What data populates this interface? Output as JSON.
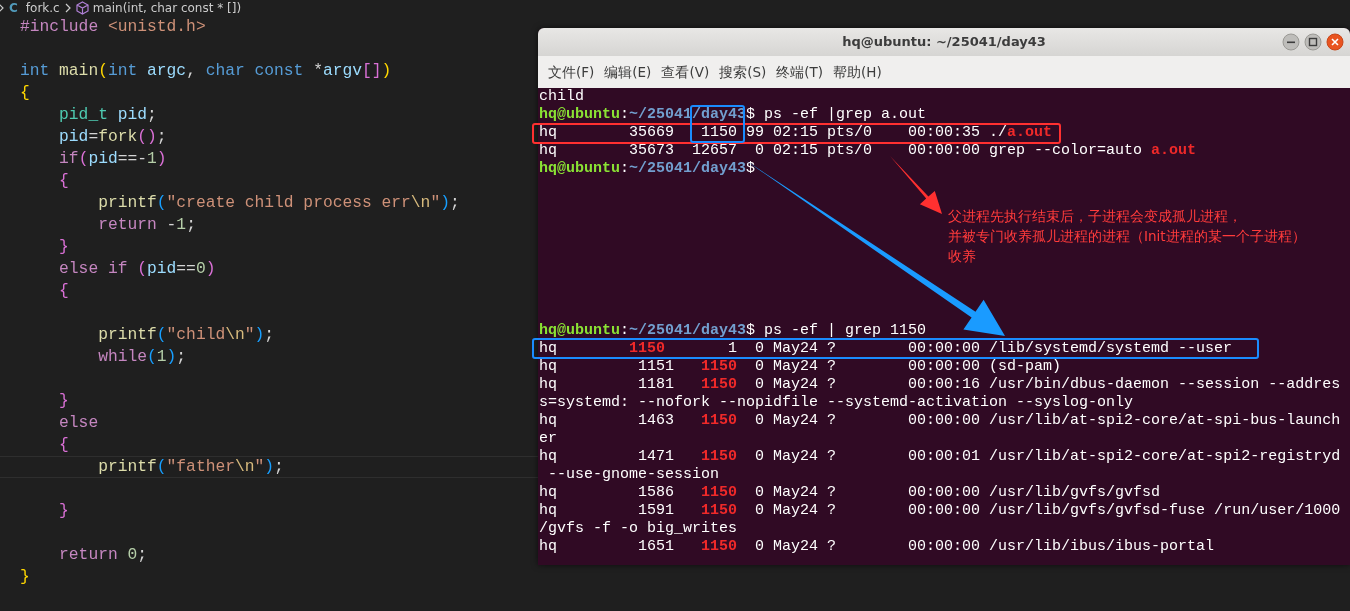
{
  "editor": {
    "breadcrumb": [
      {
        "kind": "chevron"
      },
      {
        "kind": "file",
        "icon_text": "C",
        "label": "fork.c"
      },
      {
        "kind": "chevron"
      },
      {
        "kind": "symbol",
        "label": "main(int, char const * [])"
      }
    ],
    "code_lines": [
      {
        "current": false,
        "tokens": [
          {
            "text": "#include",
            "kind": "pre"
          },
          {
            "text": " <unistd.h>",
            "kind": "inc"
          }
        ]
      },
      {
        "current": false
      },
      {
        "current": false,
        "tokens": [
          {
            "text": "int",
            "kind": "kw"
          },
          {
            "text": " main",
            "kind": "fn"
          },
          {
            "text": "(",
            "kind": "b1"
          },
          {
            "text": "int",
            "kind": "kw"
          },
          {
            "text": " argc",
            "kind": "var"
          },
          {
            "text": ", ",
            "kind": "p"
          },
          {
            "text": "char const",
            "kind": "kw"
          },
          {
            "text": " *",
            "kind": "p"
          },
          {
            "text": "argv",
            "kind": "var"
          },
          {
            "text": "[]",
            "kind": "b2"
          },
          {
            "text": ")",
            "kind": "b1"
          }
        ]
      },
      {
        "current": false,
        "tokens": [
          {
            "text": "{",
            "kind": "b1"
          }
        ]
      },
      {
        "current": false,
        "tokens": [
          {
            "text": "    pid_t",
            "kind": "type"
          },
          {
            "text": " pid",
            "kind": "var"
          },
          {
            "text": ";",
            "kind": "p"
          }
        ]
      },
      {
        "current": false,
        "tokens": [
          {
            "text": "    pid",
            "kind": "var"
          },
          {
            "text": "=",
            "kind": "p"
          },
          {
            "text": "fork",
            "kind": "fn"
          },
          {
            "text": "()",
            "kind": "b2"
          },
          {
            "text": ";",
            "kind": "p"
          }
        ]
      },
      {
        "current": false,
        "tokens": [
          {
            "text": "    if",
            "kind": "ctl"
          },
          {
            "text": "(",
            "kind": "b2"
          },
          {
            "text": "pid",
            "kind": "var"
          },
          {
            "text": "==-",
            "kind": "p"
          },
          {
            "text": "1",
            "kind": "num"
          },
          {
            "text": ")",
            "kind": "b2"
          }
        ]
      },
      {
        "current": false,
        "tokens": [
          {
            "text": "    {",
            "kind": "b2"
          }
        ]
      },
      {
        "current": false,
        "tokens": [
          {
            "text": "        printf",
            "kind": "fn"
          },
          {
            "text": "(",
            "kind": "b3"
          },
          {
            "text": "\"create child process err",
            "kind": "str"
          },
          {
            "text": "\\n",
            "kind": "esc"
          },
          {
            "text": "\"",
            "kind": "str"
          },
          {
            "text": ")",
            "kind": "b3"
          },
          {
            "text": ";",
            "kind": "p"
          }
        ]
      },
      {
        "current": false,
        "tokens": [
          {
            "text": "        return",
            "kind": "ctl"
          },
          {
            "text": " -",
            "kind": "p"
          },
          {
            "text": "1",
            "kind": "num"
          },
          {
            "text": ";",
            "kind": "p"
          }
        ]
      },
      {
        "current": false,
        "tokens": [
          {
            "text": "    }",
            "kind": "b2"
          }
        ]
      },
      {
        "current": false,
        "tokens": [
          {
            "text": "    else if ",
            "kind": "ctl"
          },
          {
            "text": "(",
            "kind": "b2"
          },
          {
            "text": "pid",
            "kind": "var"
          },
          {
            "text": "==",
            "kind": "p"
          },
          {
            "text": "0",
            "kind": "num"
          },
          {
            "text": ")",
            "kind": "b2"
          }
        ]
      },
      {
        "current": false,
        "tokens": [
          {
            "text": "    {",
            "kind": "b2"
          }
        ]
      },
      {
        "current": false
      },
      {
        "current": false,
        "tokens": [
          {
            "text": "        printf",
            "kind": "fn"
          },
          {
            "text": "(",
            "kind": "b3"
          },
          {
            "text": "\"child",
            "kind": "str"
          },
          {
            "text": "\\n",
            "kind": "esc"
          },
          {
            "text": "\"",
            "kind": "str"
          },
          {
            "text": ")",
            "kind": "b3"
          },
          {
            "text": ";",
            "kind": "p"
          }
        ]
      },
      {
        "current": false,
        "tokens": [
          {
            "text": "        while",
            "kind": "ctl"
          },
          {
            "text": "(",
            "kind": "b3"
          },
          {
            "text": "1",
            "kind": "num"
          },
          {
            "text": ")",
            "kind": "b3"
          },
          {
            "text": ";",
            "kind": "p"
          }
        ]
      },
      {
        "current": false
      },
      {
        "current": false,
        "tokens": [
          {
            "text": "    }",
            "kind": "b2"
          }
        ]
      },
      {
        "current": false,
        "tokens": [
          {
            "text": "    else",
            "kind": "ctl"
          }
        ]
      },
      {
        "current": false,
        "tokens": [
          {
            "text": "    {",
            "kind": "b2"
          }
        ]
      },
      {
        "current": true,
        "tokens": [
          {
            "text": "        printf",
            "kind": "fn"
          },
          {
            "text": "(",
            "kind": "b3"
          },
          {
            "text": "\"father",
            "kind": "str"
          },
          {
            "text": "\\n",
            "kind": "esc"
          },
          {
            "text": "\"",
            "kind": "str"
          },
          {
            "text": ")",
            "kind": "b3"
          },
          {
            "text": ";",
            "kind": "p"
          }
        ]
      },
      {
        "current": false
      },
      {
        "current": false,
        "tokens": [
          {
            "text": "    }",
            "kind": "b2"
          }
        ]
      },
      {
        "current": false
      },
      {
        "current": false,
        "tokens": [
          {
            "text": "    return ",
            "kind": "ctl"
          },
          {
            "text": "0",
            "kind": "num"
          },
          {
            "text": ";",
            "kind": "p"
          }
        ]
      },
      {
        "current": false,
        "tokens": [
          {
            "text": "}",
            "kind": "b1"
          }
        ]
      }
    ]
  },
  "terminal": {
    "title": "hq@ubuntu: ~/25041/day43",
    "menu": [
      "文件(F)",
      "编辑(E)",
      "查看(V)",
      "搜索(S)",
      "终端(T)",
      "帮助(H)"
    ],
    "output_top": [
      [
        {
          "text": "child",
          "kind": "plain"
        }
      ],
      [
        {
          "text": "hq@ubuntu",
          "kind": "user"
        },
        {
          "text": ":",
          "kind": "plain"
        },
        {
          "text": "~/25041/",
          "kind": "path"
        },
        {
          "text": "day43",
          "kind": "path"
        },
        {
          "text": "$ ps -ef |grep a.out",
          "kind": "plain"
        }
      ],
      [
        {
          "text": "hq        35669   1150 99 02:15 pts/0    00:00:35 ./",
          "kind": "plain"
        },
        {
          "text": "a.out",
          "kind": "match"
        }
      ],
      [
        {
          "text": "hq        35673  12657  0 02:15 pts/0    00:00:00 grep --color=auto ",
          "kind": "plain"
        },
        {
          "text": "a.out",
          "kind": "match"
        }
      ],
      [
        {
          "text": "hq@ubuntu",
          "kind": "user"
        },
        {
          "text": ":",
          "kind": "plain"
        },
        {
          "text": "~/25041/day43",
          "kind": "path"
        },
        {
          "text": "$",
          "kind": "plain"
        }
      ]
    ],
    "output_bottom": [
      [
        {
          "text": "hq@ubuntu",
          "kind": "user"
        },
        {
          "text": ":",
          "kind": "plain"
        },
        {
          "text": "~/25041/day43",
          "kind": "path"
        },
        {
          "text": "$ ps -ef | grep 1150",
          "kind": "plain"
        }
      ],
      [
        {
          "text": "hq        ",
          "kind": "plain"
        },
        {
          "text": "1150",
          "kind": "match"
        },
        {
          "text": "       1  0 May24 ?        00:00:00 /lib/systemd/systemd --user",
          "kind": "plain"
        }
      ],
      [
        {
          "text": "hq         1151   ",
          "kind": "plain"
        },
        {
          "text": "1150",
          "kind": "match"
        },
        {
          "text": "  0 May24 ?        00:00:00 (sd-pam)",
          "kind": "plain"
        }
      ],
      [
        {
          "text": "hq         1181   ",
          "kind": "plain"
        },
        {
          "text": "1150",
          "kind": "match"
        },
        {
          "text": "  0 May24 ?        00:00:16 /usr/bin/dbus-daemon --session --addres",
          "kind": "plain"
        }
      ],
      [
        {
          "text": "s=systemd: --nofork --nopidfile --systemd-activation --syslog-only",
          "kind": "plain"
        }
      ],
      [
        {
          "text": "hq         1463   ",
          "kind": "plain"
        },
        {
          "text": "1150",
          "kind": "match"
        },
        {
          "text": "  0 May24 ?        00:00:00 /usr/lib/at-spi2-core/at-spi-bus-launch",
          "kind": "plain"
        }
      ],
      [
        {
          "text": "er",
          "kind": "plain"
        }
      ],
      [
        {
          "text": "hq         1471   ",
          "kind": "plain"
        },
        {
          "text": "1150",
          "kind": "match"
        },
        {
          "text": "  0 May24 ?        00:00:01 /usr/lib/at-spi2-core/at-spi2-registryd",
          "kind": "plain"
        }
      ],
      [
        {
          "text": " --use-gnome-session",
          "kind": "plain"
        }
      ],
      [
        {
          "text": "hq         1586   ",
          "kind": "plain"
        },
        {
          "text": "1150",
          "kind": "match"
        },
        {
          "text": "  0 May24 ?        00:00:00 /usr/lib/gvfs/gvfsd",
          "kind": "plain"
        }
      ],
      [
        {
          "text": "hq         1591   ",
          "kind": "plain"
        },
        {
          "text": "1150",
          "kind": "match"
        },
        {
          "text": "  0 May24 ?        00:00:00 /usr/lib/gvfs/gvfsd-fuse /run/user/1000",
          "kind": "plain"
        }
      ],
      [
        {
          "text": "/gvfs -f -o big_writes",
          "kind": "plain"
        }
      ],
      [
        {
          "text": "hq         1651   ",
          "kind": "plain"
        },
        {
          "text": "1150",
          "kind": "match"
        },
        {
          "text": "  0 May24 ?        00:00:00 /usr/lib/ibus/ibus-portal",
          "kind": "plain"
        }
      ]
    ]
  },
  "annotation": {
    "note_lines": [
      "父进程先执行结束后，子进程会变成孤儿进程，",
      "并被专门收养孤儿进程的进程（Init进程的某一个子进程）",
      "收养"
    ]
  },
  "markup": [
    {
      "kind": "box",
      "color": "#ff3030"
    },
    {
      "kind": "box",
      "color": "#1a8cff"
    },
    {
      "kind": "arrow",
      "color": "#ff3030"
    },
    {
      "kind": "arrow",
      "color": "#1a9bff"
    },
    {
      "kind": "box",
      "color": "#1a8cff"
    }
  ]
}
